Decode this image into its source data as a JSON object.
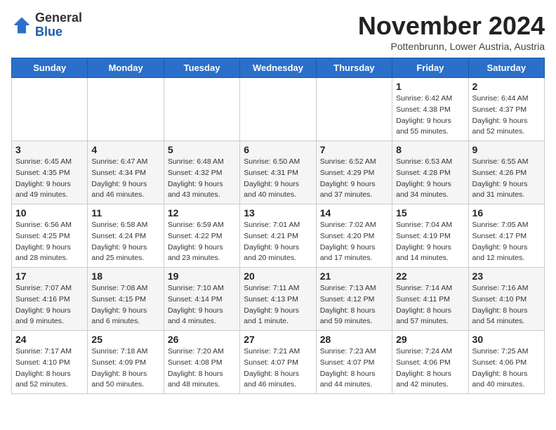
{
  "logo": {
    "general": "General",
    "blue": "Blue"
  },
  "title": "November 2024",
  "location": "Pottenbrunn, Lower Austria, Austria",
  "days_of_week": [
    "Sunday",
    "Monday",
    "Tuesday",
    "Wednesday",
    "Thursday",
    "Friday",
    "Saturday"
  ],
  "weeks": [
    [
      {
        "day": "",
        "info": ""
      },
      {
        "day": "",
        "info": ""
      },
      {
        "day": "",
        "info": ""
      },
      {
        "day": "",
        "info": ""
      },
      {
        "day": "",
        "info": ""
      },
      {
        "day": "1",
        "info": "Sunrise: 6:42 AM\nSunset: 4:38 PM\nDaylight: 9 hours\nand 55 minutes."
      },
      {
        "day": "2",
        "info": "Sunrise: 6:44 AM\nSunset: 4:37 PM\nDaylight: 9 hours\nand 52 minutes."
      }
    ],
    [
      {
        "day": "3",
        "info": "Sunrise: 6:45 AM\nSunset: 4:35 PM\nDaylight: 9 hours\nand 49 minutes."
      },
      {
        "day": "4",
        "info": "Sunrise: 6:47 AM\nSunset: 4:34 PM\nDaylight: 9 hours\nand 46 minutes."
      },
      {
        "day": "5",
        "info": "Sunrise: 6:48 AM\nSunset: 4:32 PM\nDaylight: 9 hours\nand 43 minutes."
      },
      {
        "day": "6",
        "info": "Sunrise: 6:50 AM\nSunset: 4:31 PM\nDaylight: 9 hours\nand 40 minutes."
      },
      {
        "day": "7",
        "info": "Sunrise: 6:52 AM\nSunset: 4:29 PM\nDaylight: 9 hours\nand 37 minutes."
      },
      {
        "day": "8",
        "info": "Sunrise: 6:53 AM\nSunset: 4:28 PM\nDaylight: 9 hours\nand 34 minutes."
      },
      {
        "day": "9",
        "info": "Sunrise: 6:55 AM\nSunset: 4:26 PM\nDaylight: 9 hours\nand 31 minutes."
      }
    ],
    [
      {
        "day": "10",
        "info": "Sunrise: 6:56 AM\nSunset: 4:25 PM\nDaylight: 9 hours\nand 28 minutes."
      },
      {
        "day": "11",
        "info": "Sunrise: 6:58 AM\nSunset: 4:24 PM\nDaylight: 9 hours\nand 25 minutes."
      },
      {
        "day": "12",
        "info": "Sunrise: 6:59 AM\nSunset: 4:22 PM\nDaylight: 9 hours\nand 23 minutes."
      },
      {
        "day": "13",
        "info": "Sunrise: 7:01 AM\nSunset: 4:21 PM\nDaylight: 9 hours\nand 20 minutes."
      },
      {
        "day": "14",
        "info": "Sunrise: 7:02 AM\nSunset: 4:20 PM\nDaylight: 9 hours\nand 17 minutes."
      },
      {
        "day": "15",
        "info": "Sunrise: 7:04 AM\nSunset: 4:19 PM\nDaylight: 9 hours\nand 14 minutes."
      },
      {
        "day": "16",
        "info": "Sunrise: 7:05 AM\nSunset: 4:17 PM\nDaylight: 9 hours\nand 12 minutes."
      }
    ],
    [
      {
        "day": "17",
        "info": "Sunrise: 7:07 AM\nSunset: 4:16 PM\nDaylight: 9 hours\nand 9 minutes."
      },
      {
        "day": "18",
        "info": "Sunrise: 7:08 AM\nSunset: 4:15 PM\nDaylight: 9 hours\nand 6 minutes."
      },
      {
        "day": "19",
        "info": "Sunrise: 7:10 AM\nSunset: 4:14 PM\nDaylight: 9 hours\nand 4 minutes."
      },
      {
        "day": "20",
        "info": "Sunrise: 7:11 AM\nSunset: 4:13 PM\nDaylight: 9 hours\nand 1 minute."
      },
      {
        "day": "21",
        "info": "Sunrise: 7:13 AM\nSunset: 4:12 PM\nDaylight: 8 hours\nand 59 minutes."
      },
      {
        "day": "22",
        "info": "Sunrise: 7:14 AM\nSunset: 4:11 PM\nDaylight: 8 hours\nand 57 minutes."
      },
      {
        "day": "23",
        "info": "Sunrise: 7:16 AM\nSunset: 4:10 PM\nDaylight: 8 hours\nand 54 minutes."
      }
    ],
    [
      {
        "day": "24",
        "info": "Sunrise: 7:17 AM\nSunset: 4:10 PM\nDaylight: 8 hours\nand 52 minutes."
      },
      {
        "day": "25",
        "info": "Sunrise: 7:18 AM\nSunset: 4:09 PM\nDaylight: 8 hours\nand 50 minutes."
      },
      {
        "day": "26",
        "info": "Sunrise: 7:20 AM\nSunset: 4:08 PM\nDaylight: 8 hours\nand 48 minutes."
      },
      {
        "day": "27",
        "info": "Sunrise: 7:21 AM\nSunset: 4:07 PM\nDaylight: 8 hours\nand 46 minutes."
      },
      {
        "day": "28",
        "info": "Sunrise: 7:23 AM\nSunset: 4:07 PM\nDaylight: 8 hours\nand 44 minutes."
      },
      {
        "day": "29",
        "info": "Sunrise: 7:24 AM\nSunset: 4:06 PM\nDaylight: 8 hours\nand 42 minutes."
      },
      {
        "day": "30",
        "info": "Sunrise: 7:25 AM\nSunset: 4:06 PM\nDaylight: 8 hours\nand 40 minutes."
      }
    ]
  ]
}
